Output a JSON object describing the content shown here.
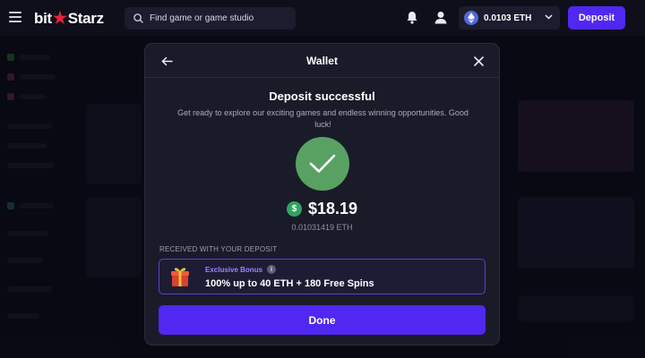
{
  "header": {
    "logo_left": "bit",
    "logo_star": "★",
    "logo_right": "Starz",
    "search_placeholder": "Find game or game studio",
    "balance": "0.0103 ETH",
    "deposit_label": "Deposit"
  },
  "modal": {
    "title": "Wallet",
    "success_title": "Deposit successful",
    "success_sub": "Get ready to explore our exciting games and endless winning opportunities. Good luck!",
    "usd_symbol": "$",
    "amount_usd": "$18.19",
    "amount_eth": "0.01031419 ETH",
    "received_label": "RECEIVED WITH YOUR DEPOSIT",
    "bonus_tag": "Exclusive Bonus",
    "bonus_info": "i",
    "bonus_text": "100% up to 40 ETH + 180 Free Spins",
    "done_label": "Done"
  },
  "colors": {
    "accent": "#5127f2",
    "success": "#58a163",
    "bonus_tag": "#9d84ff"
  },
  "icons": {
    "menu": "hamburger-icon",
    "search": "search-icon",
    "bell": "bell-icon",
    "user": "user-icon",
    "eth": "ethereum-icon",
    "chevron": "chevron-down-icon",
    "back": "arrow-left-icon",
    "close": "close-icon",
    "check": "check-icon",
    "gift": "gift-icon",
    "dollar": "dollar-coin-icon",
    "info": "info-icon"
  }
}
